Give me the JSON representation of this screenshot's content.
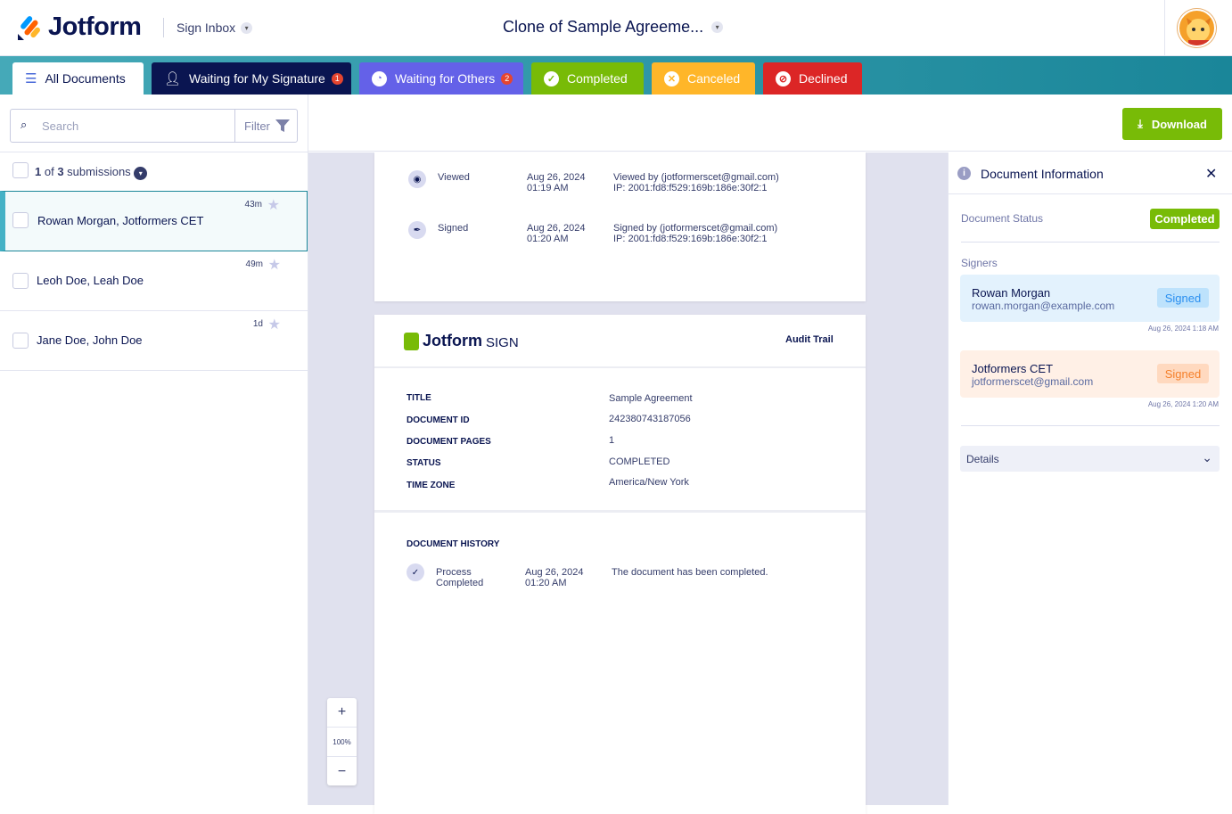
{
  "header": {
    "logo": "Jotform",
    "inbox_label": "Sign Inbox",
    "doc_title": "Clone of Sample Agreeme..."
  },
  "tabs": [
    {
      "label": "All Documents",
      "color": "#ffffff"
    },
    {
      "label": "Waiting for My Signature",
      "badge": "1",
      "color": "#0a1551"
    },
    {
      "label": "Waiting for Others",
      "badge": "2",
      "color": "#6461e8"
    },
    {
      "label": "Completed",
      "color": "#78bb07"
    },
    {
      "label": "Canceled",
      "color": "#ffb629"
    },
    {
      "label": "Declined",
      "color": "#dc2626"
    }
  ],
  "left": {
    "search_placeholder": "Search",
    "filter_label": "Filter",
    "count_current": "1",
    "count_of": " of ",
    "count_total": "3",
    "count_suffix": " submissions",
    "items": [
      {
        "name": "Rowan Morgan, Jotformers CET",
        "time": "43m"
      },
      {
        "name": "Leoh Doe, Leah Doe",
        "time": "49m"
      },
      {
        "name": "Jane Doe, John Doe",
        "time": "1d"
      }
    ]
  },
  "toolbar": {
    "download": "Download"
  },
  "audit_top": [
    {
      "action": "Viewed",
      "date": "Aug 26, 2024",
      "time": "01:19 AM",
      "detail": "Viewed by (jotformerscet@gmail.com)",
      "ip": "IP: 2001:fd8:f529:169b:186e:30f2:1"
    },
    {
      "action": "Signed",
      "date": "Aug 26, 2024",
      "time": "01:20 AM",
      "detail": "Signed by (jotformerscet@gmail.com)",
      "ip": "IP: 2001:fd8:f529:169b:186e:30f2:1"
    }
  ],
  "audit": {
    "logo_main": "Jotform",
    "logo_sign": "SIGN",
    "heading": "Audit Trail",
    "fields": [
      {
        "label": "TITLE",
        "value": "Sample Agreement"
      },
      {
        "label": "DOCUMENT ID",
        "value": "242380743187056"
      },
      {
        "label": "DOCUMENT PAGES",
        "value": "1"
      },
      {
        "label": "STATUS",
        "value": "COMPLETED"
      },
      {
        "label": "TIME ZONE",
        "value": "America/New York"
      }
    ],
    "history_title": "DOCUMENT HISTORY",
    "history": {
      "action1": "Process",
      "action2": "Completed",
      "date": "Aug 26, 2024",
      "time": "01:20 AM",
      "detail": "The document has been completed."
    }
  },
  "zoom": {
    "plus": "+",
    "level": "100%",
    "minus": "−"
  },
  "info": {
    "title": "Document Information",
    "status_label": "Document Status",
    "status": "Completed",
    "signers_label": "Signers",
    "signers": [
      {
        "name": "Rowan Morgan",
        "email": "rowan.morgan@example.com",
        "status": "Signed",
        "date": "Aug 26, 2024 1:18 AM"
      },
      {
        "name": "Jotformers CET",
        "email": "jotformerscet@gmail.com",
        "status": "Signed",
        "date": "Aug 26, 2024 1:20 AM"
      }
    ],
    "details": "Details"
  }
}
